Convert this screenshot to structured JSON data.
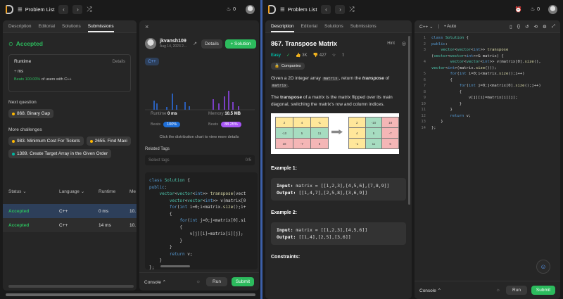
{
  "left": {
    "topbar": {
      "title": "Problem List",
      "fire_count": "0"
    },
    "tabs": [
      "Description",
      "Editorial",
      "Solutions",
      "Submissions"
    ],
    "status": "Accepted",
    "runtime": {
      "label": "Runtime",
      "details": "Details",
      "value": "ms",
      "beats_pct": "Beats 100.00%",
      "beats_rest": "of users with C++"
    },
    "next_question": {
      "label": "Next question",
      "item": "868. Binary Gap"
    },
    "more_challenges": {
      "label": "More challenges",
      "items": [
        "983. Minimum Cost For Tickets",
        "2655. Find Maxi",
        "1389. Create Target Array in the Given Order"
      ]
    },
    "table": {
      "headers": [
        "Status",
        "Language",
        "Runtime",
        "Me"
      ],
      "rows": [
        {
          "status": "Accepted",
          "lang": "C++",
          "runtime": "0 ms",
          "mem": "10."
        },
        {
          "status": "Accepted",
          "lang": "C++",
          "runtime": "14 ms",
          "mem": "10."
        }
      ]
    },
    "detail": {
      "user": "jkvansh109",
      "date": "Aug 14, 2023 2...",
      "details_btn": "Details",
      "solution_btn": "+ Solution",
      "lang": "C++",
      "runtime_label": "Runtime",
      "runtime_val": "0 ms",
      "memory_label": "Memory",
      "memory_val": "10.5 MB",
      "beats_label": "Beats",
      "beats_runtime": "100%",
      "beats_memory": "88.25%",
      "hint": "Click the distribution chart to view more details",
      "related_tags": "Related Tags",
      "tags_placeholder": "Select tags",
      "tags_count": "0/5",
      "code": [
        "class Solution {",
        "public:",
        "    vector<vector<int>> transpose(vect",
        "        vector<vector<int>> v(matrix[0",
        "        for(int i=0;i<matrix.size();i+",
        "        {",
        "            for(int j=0;j<matrix[0].si",
        "            {",
        "                v[j][i]=matrix[i][j];",
        "            }",
        "        }",
        "        return v;",
        "    }",
        "};"
      ]
    },
    "console": {
      "label": "Console",
      "run": "Run",
      "submit": "Submit"
    }
  },
  "right": {
    "topbar": {
      "title": "Problem List",
      "fire_count": "0"
    },
    "tabs": [
      "Description",
      "Editorial",
      "Solutions",
      "Submissions"
    ],
    "problem": {
      "title": "867. Transpose Matrix",
      "hint": "Hint",
      "difficulty": "Easy",
      "likes": "3K",
      "dislikes": "427",
      "companies": "Companies",
      "desc1_a": "Given a 2D integer array ",
      "desc1_code": "matrix",
      "desc1_b": ", return the ",
      "desc1_em": "transpose",
      "desc1_c": " of",
      "desc1_code2": "matrix",
      "desc2_a": "The ",
      "desc2_b": "transpose",
      "desc2_c": " of a matrix is the matrix flipped over its main diagonal, switching the matrix's row and column indices.",
      "matrix_left": [
        [
          "2",
          "4",
          "-1"
        ],
        [
          "-10",
          "5",
          "11"
        ],
        [
          "18",
          "-7",
          "6"
        ]
      ],
      "matrix_right": [
        [
          "2",
          "-10",
          "18"
        ],
        [
          "4",
          "5",
          "-7"
        ],
        [
          "-1",
          "11",
          "6"
        ]
      ],
      "ex1_label": "Example 1:",
      "ex1_input_label": "Input:",
      "ex1_input": " matrix = [[1,2,3],[4,5,6],[7,8,9]]",
      "ex1_output_label": "Output:",
      "ex1_output": " [[1,4,7],[2,5,8],[3,6,9]]",
      "ex2_label": "Example 2:",
      "ex2_input_label": "Input:",
      "ex2_input": " matrix = [[1,2,3],[4,5,6]]",
      "ex2_output_label": "Output:",
      "ex2_output": " [[1,4],[2,5],[3,6]]",
      "constraints": "Constraints:"
    },
    "editor": {
      "lang": "C++",
      "auto": "Auto",
      "code": [
        "class Solution {",
        "public:",
        "    vector<vector<int>> transpose",
        "(vector<vector<int>>& matrix) {",
        "        vector<vector<int>> v(matrix[0].size(),",
        "vector<int>(matrix.size()));",
        "        for(int i=0;i<matrix.size();i++)",
        "        {",
        "            for(int j=0;j<matrix[0].size();j++)",
        "            {",
        "                v[j][i]=matrix[i][j];",
        "            }",
        "        }",
        "        return v;",
        "    }",
        "};"
      ],
      "line_numbers": [
        "1",
        "2",
        "3",
        "",
        "4",
        "",
        "5",
        "6",
        "7",
        "8",
        "9",
        "10",
        "11",
        "12",
        "13",
        "14"
      ]
    },
    "console": {
      "label": "Console",
      "run": "Run",
      "submit": "Submit"
    }
  },
  "colors": {
    "accent_green": "#2cbb5d",
    "easy": "#00b8a3",
    "blue_badge": "#1e6fd9",
    "purple_badge": "#a855f7",
    "selection_blue": "#2d3f5a"
  }
}
